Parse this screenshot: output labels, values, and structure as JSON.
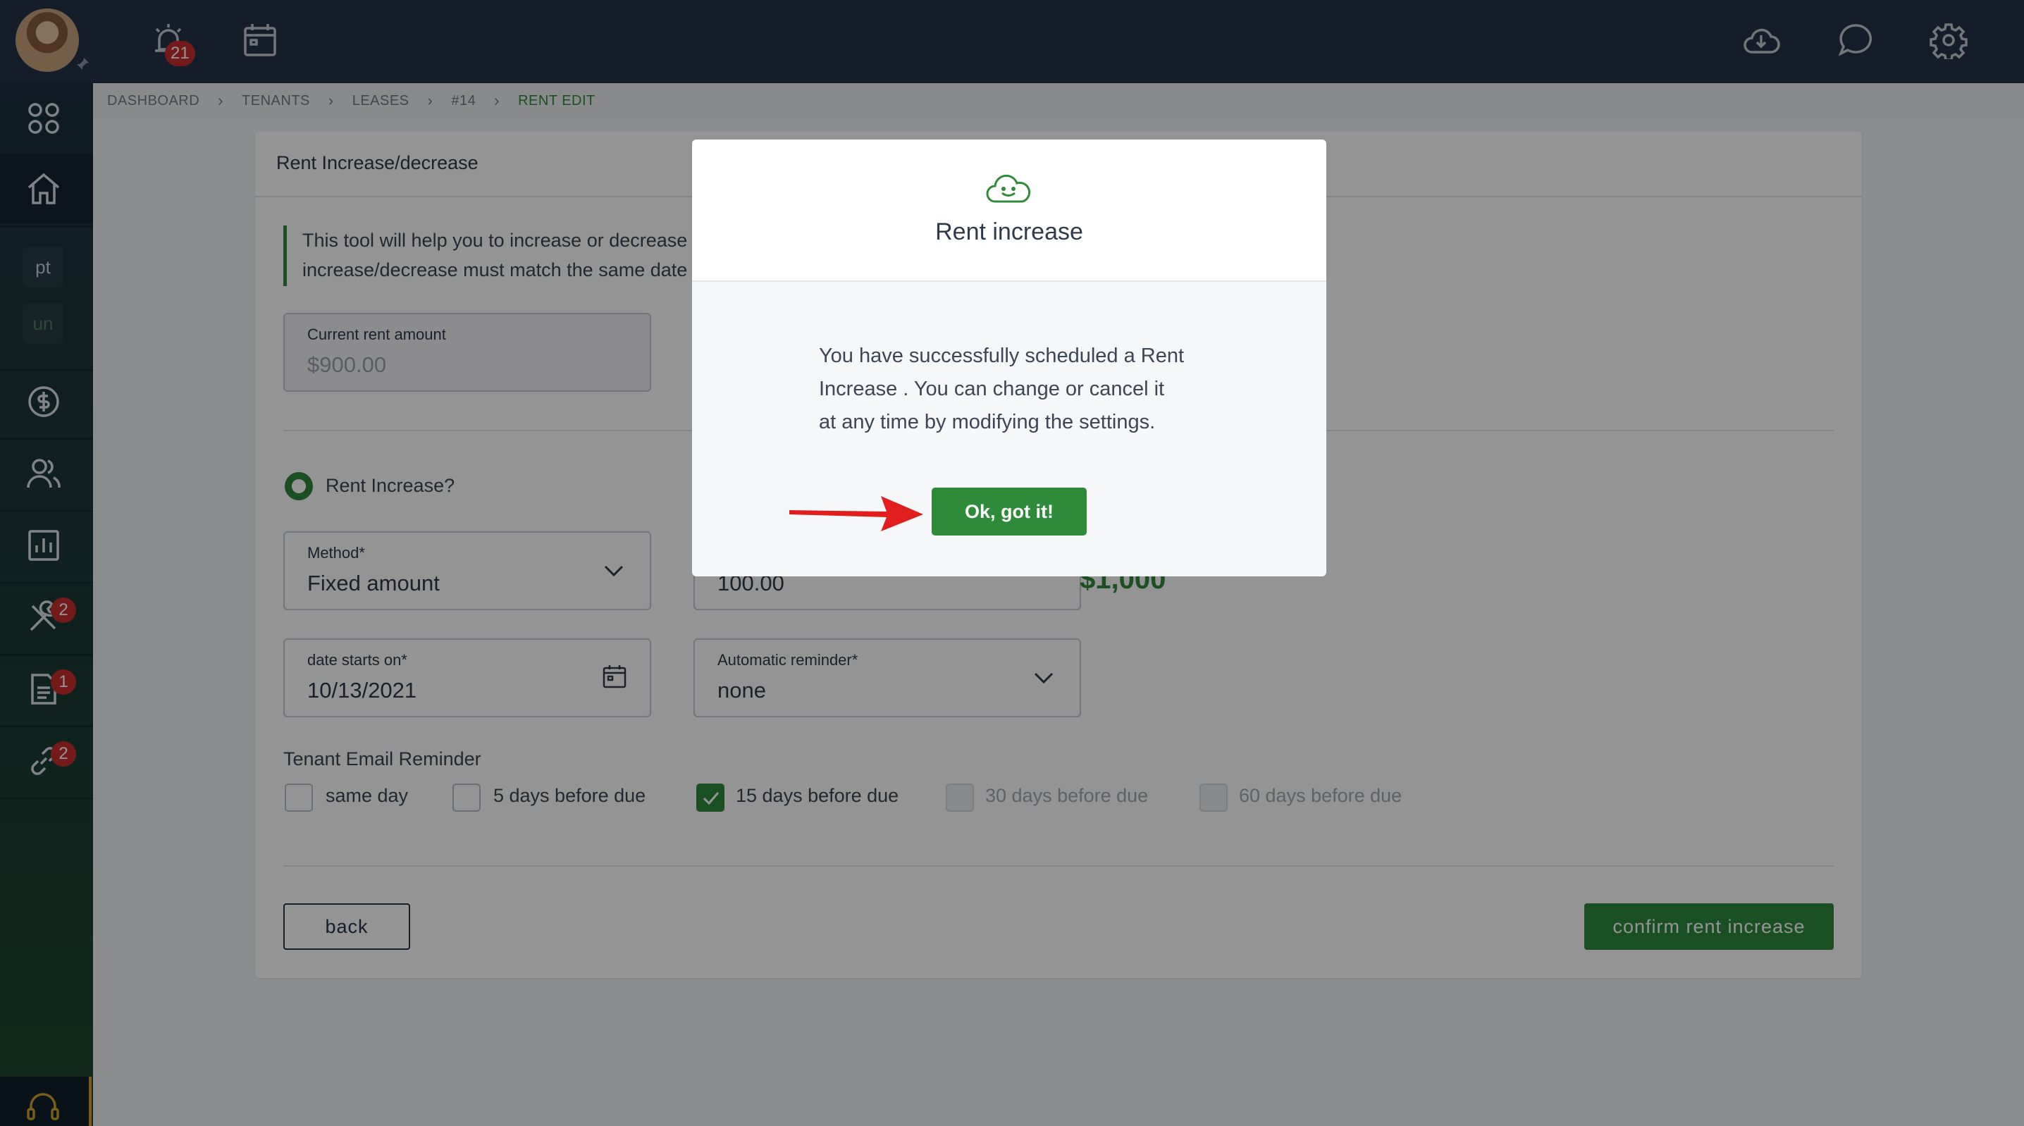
{
  "topbar": {
    "alerts_badge": "21"
  },
  "sidebar": {
    "pill_1": "pt",
    "pill_2": "un",
    "badges": {
      "maintenance": "2",
      "documents": "1",
      "links": "2"
    }
  },
  "breadcrumb": [
    "DASHBOARD",
    "TENANTS",
    "LEASES",
    "#14",
    "RENT EDIT"
  ],
  "card": {
    "title": "Rent Increase/decrease",
    "info_line_1": "This tool will help you to increase or decrease",
    "info_line_2": "increase/decrease must match the same date",
    "current_rent": {
      "label": "Current rent amount",
      "value": "$900.00"
    },
    "rent_increase_label": "Rent Increase?",
    "method": {
      "label": "Method*",
      "value": "Fixed amount"
    },
    "amount": {
      "value": "100.00"
    },
    "new_total": "$1,000",
    "date_starts": {
      "label": "date starts on*",
      "value": "10/13/2021"
    },
    "reminder": {
      "label": "Automatic reminder*",
      "value": "none"
    },
    "email_reminder": {
      "label": "Tenant Email Reminder",
      "options": [
        {
          "label": "same day",
          "checked": false,
          "disabled": false
        },
        {
          "label": "5 days before due",
          "checked": false,
          "disabled": false
        },
        {
          "label": "15 days before due",
          "checked": true,
          "disabled": false
        },
        {
          "label": "30 days before due",
          "checked": false,
          "disabled": true
        },
        {
          "label": "60 days before due",
          "checked": false,
          "disabled": true
        }
      ]
    },
    "back_label": "back",
    "confirm_label": "confirm rent increase"
  },
  "modal": {
    "title": "Rent increase",
    "message_line_1": "You have successfully scheduled a Rent",
    "message_line_2": "Increase . You can change or cancel it",
    "message_line_3": "at any time by modifying the settings.",
    "ok_label": "Ok, got it!"
  },
  "colors": {
    "topbar": "#243348",
    "accent_green": "#2e8b39",
    "badge_red": "#c9302c",
    "annotation_arrow": "#e01e1e"
  }
}
